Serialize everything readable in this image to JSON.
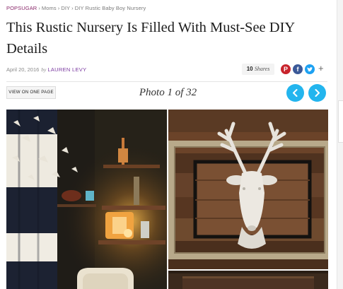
{
  "breadcrumb": {
    "items": [
      "POPSUGAR",
      "Moms",
      "DIY",
      "DIY Rustic Baby Boy Nursery"
    ],
    "separator": "›"
  },
  "article": {
    "title": "This Rustic Nursery Is Filled With Must-See DIY Details",
    "date": "April 20, 2016",
    "by": "by",
    "author": "LAUREN LEVY"
  },
  "share": {
    "count": "10",
    "label": "Shares",
    "icons": [
      "pinterest-icon",
      "facebook-icon",
      "twitter-icon",
      "plus-icon"
    ],
    "colors": {
      "pinterest": "#c8232c",
      "facebook": "#3b5998",
      "twitter": "#1da1f2"
    }
  },
  "gallery": {
    "view_one_page_label": "VIEW ON ONE PAGE",
    "photo_label": "Photo 1 of 32",
    "nav_color": "#23b5ee",
    "images": [
      "nursery corner with striped curtain, paper birds, shelves and lamp",
      "white faux deer head mounted on wooden plank frame",
      "bottom crop of next photo"
    ]
  }
}
